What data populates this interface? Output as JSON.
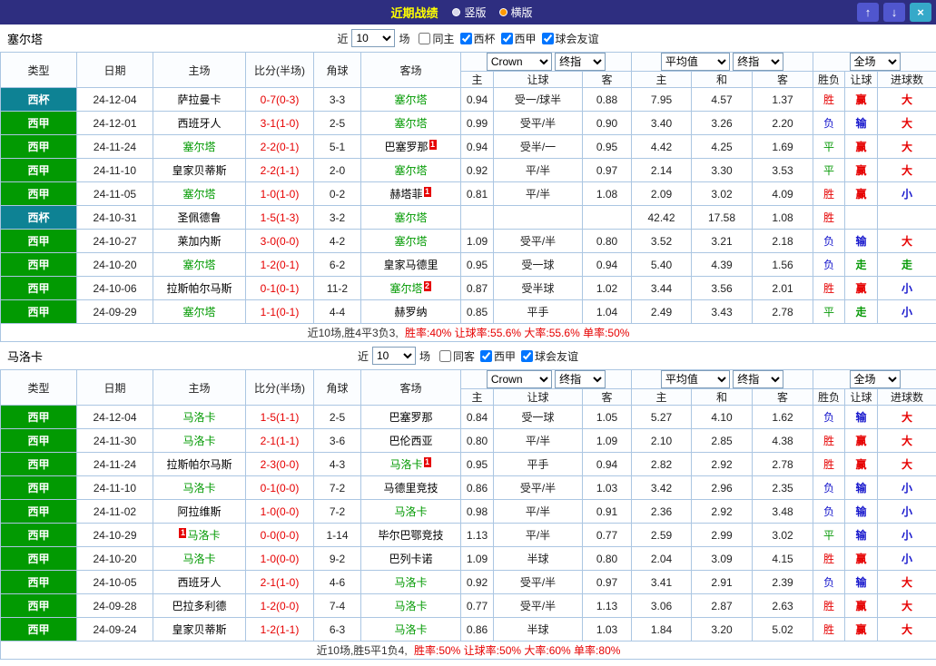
{
  "topbar": {
    "title": "近期战绩",
    "layout_radios": [
      {
        "label": "竖版",
        "selected": false
      },
      {
        "label": "横版",
        "selected": true
      }
    ],
    "buttons": {
      "up": "↑",
      "down": "↓",
      "close": "×"
    }
  },
  "table": {
    "main_columns": [
      "类型",
      "日期",
      "主场",
      "比分(半场)",
      "角球",
      "客场"
    ],
    "sub_columns": [
      "主",
      "让球",
      "客",
      "主",
      "和",
      "客",
      "胜负",
      "让球",
      "进球数"
    ],
    "controls": {
      "company": "Crown",
      "company_type": "终指",
      "euro": "平均值",
      "euro_type": "终指",
      "scope": "全场"
    }
  },
  "sections": [
    {
      "team": "塞尔塔",
      "filter": {
        "prefix": "近",
        "count": "10",
        "suffix": "场",
        "checkboxes": [
          {
            "label": "同主",
            "checked": false
          },
          {
            "label": "西杯",
            "checked": true
          },
          {
            "label": "西甲",
            "checked": true
          },
          {
            "label": "球会友谊",
            "checked": true
          }
        ]
      },
      "rows": [
        {
          "type": "西杯",
          "kind": "cup",
          "date": "24-12-04",
          "home": {
            "name": "萨拉曼卡"
          },
          "score": "0-7(0-3)",
          "corners": "3-3",
          "away": {
            "name": "塞尔塔",
            "focal": true
          },
          "asian": [
            "0.94",
            "受一/球半",
            "0.88"
          ],
          "euro": [
            "7.95",
            "4.57",
            "1.37"
          ],
          "outcome": [
            "胜",
            "r"
          ],
          "hcp": [
            "赢",
            "r"
          ],
          "goal": [
            "大",
            "r"
          ]
        },
        {
          "type": "西甲",
          "kind": "liga",
          "date": "24-12-01",
          "home": {
            "name": "西班牙人"
          },
          "score": "3-1(1-0)",
          "corners": "2-5",
          "away": {
            "name": "塞尔塔",
            "focal": true
          },
          "asian": [
            "0.99",
            "受平/半",
            "0.90"
          ],
          "euro": [
            "3.40",
            "3.26",
            "2.20"
          ],
          "outcome": [
            "负",
            "b"
          ],
          "hcp": [
            "输",
            "b"
          ],
          "goal": [
            "大",
            "r"
          ]
        },
        {
          "type": "西甲",
          "kind": "liga",
          "date": "24-11-24",
          "home": {
            "name": "塞尔塔",
            "focal": true
          },
          "score": "2-2(0-1)",
          "corners": "5-1",
          "away": {
            "name": "巴塞罗那",
            "badge": "1"
          },
          "asian": [
            "0.94",
            "受半/一",
            "0.95"
          ],
          "euro": [
            "4.42",
            "4.25",
            "1.69"
          ],
          "outcome": [
            "平",
            "g"
          ],
          "hcp": [
            "赢",
            "r"
          ],
          "goal": [
            "大",
            "r"
          ]
        },
        {
          "type": "西甲",
          "kind": "liga",
          "date": "24-11-10",
          "home": {
            "name": "皇家贝蒂斯"
          },
          "score": "2-2(1-1)",
          "corners": "2-0",
          "away": {
            "name": "塞尔塔",
            "focal": true
          },
          "asian": [
            "0.92",
            "平/半",
            "0.97"
          ],
          "euro": [
            "2.14",
            "3.30",
            "3.53"
          ],
          "outcome": [
            "平",
            "g"
          ],
          "hcp": [
            "赢",
            "r"
          ],
          "goal": [
            "大",
            "r"
          ]
        },
        {
          "type": "西甲",
          "kind": "liga",
          "date": "24-11-05",
          "home": {
            "name": "塞尔塔",
            "focal": true
          },
          "score": "1-0(1-0)",
          "corners": "0-2",
          "away": {
            "name": "赫塔菲",
            "badge": "1"
          },
          "asian": [
            "0.81",
            "平/半",
            "1.08"
          ],
          "euro": [
            "2.09",
            "3.02",
            "4.09"
          ],
          "outcome": [
            "胜",
            "r"
          ],
          "hcp": [
            "赢",
            "r"
          ],
          "goal": [
            "小",
            "b"
          ]
        },
        {
          "type": "西杯",
          "kind": "cup",
          "date": "24-10-31",
          "home": {
            "name": "圣佩德鲁"
          },
          "score": "1-5(1-3)",
          "corners": "3-2",
          "away": {
            "name": "塞尔塔",
            "focal": true
          },
          "asian": [
            "",
            "",
            ""
          ],
          "euro": [
            "42.42",
            "17.58",
            "1.08"
          ],
          "outcome": [
            "胜",
            "r"
          ],
          "hcp": [
            "",
            ""
          ],
          "goal": [
            "",
            ""
          ]
        },
        {
          "type": "西甲",
          "kind": "liga",
          "date": "24-10-27",
          "home": {
            "name": "莱加内斯"
          },
          "score": "3-0(0-0)",
          "corners": "4-2",
          "away": {
            "name": "塞尔塔",
            "focal": true
          },
          "asian": [
            "1.09",
            "受平/半",
            "0.80"
          ],
          "euro": [
            "3.52",
            "3.21",
            "2.18"
          ],
          "outcome": [
            "负",
            "b"
          ],
          "hcp": [
            "输",
            "b"
          ],
          "goal": [
            "大",
            "r"
          ]
        },
        {
          "type": "西甲",
          "kind": "liga",
          "date": "24-10-20",
          "home": {
            "name": "塞尔塔",
            "focal": true
          },
          "score": "1-2(0-1)",
          "corners": "6-2",
          "away": {
            "name": "皇家马德里"
          },
          "asian": [
            "0.95",
            "受一球",
            "0.94"
          ],
          "euro": [
            "5.40",
            "4.39",
            "1.56"
          ],
          "outcome": [
            "负",
            "b"
          ],
          "hcp": [
            "走",
            "g"
          ],
          "goal": [
            "走",
            "g"
          ]
        },
        {
          "type": "西甲",
          "kind": "liga",
          "date": "24-10-06",
          "home": {
            "name": "拉斯帕尔马斯"
          },
          "score": "0-1(0-1)",
          "corners": "11-2",
          "away": {
            "name": "塞尔塔",
            "focal": true,
            "badge": "2"
          },
          "asian": [
            "0.87",
            "受半球",
            "1.02"
          ],
          "euro": [
            "3.44",
            "3.56",
            "2.01"
          ],
          "outcome": [
            "胜",
            "r"
          ],
          "hcp": [
            "赢",
            "r"
          ],
          "goal": [
            "小",
            "b"
          ]
        },
        {
          "type": "西甲",
          "kind": "liga",
          "date": "24-09-29",
          "home": {
            "name": "塞尔塔",
            "focal": true
          },
          "score": "1-1(0-1)",
          "corners": "4-4",
          "away": {
            "name": "赫罗纳"
          },
          "asian": [
            "0.85",
            "平手",
            "1.04"
          ],
          "euro": [
            "2.49",
            "3.43",
            "2.78"
          ],
          "outcome": [
            "平",
            "g"
          ],
          "hcp": [
            "走",
            "g"
          ],
          "goal": [
            "小",
            "b"
          ]
        }
      ],
      "summary": {
        "record": "近10场,胜4平3负3,",
        "rates": "胜率:40% 让球率:55.6% 大率:55.6% 单率:50%"
      }
    },
    {
      "team": "马洛卡",
      "filter": {
        "prefix": "近",
        "count": "10",
        "suffix": "场",
        "checkboxes": [
          {
            "label": "同客",
            "checked": false
          },
          {
            "label": "西甲",
            "checked": true
          },
          {
            "label": "球会友谊",
            "checked": true
          }
        ]
      },
      "rows": [
        {
          "type": "西甲",
          "kind": "liga",
          "date": "24-12-04",
          "home": {
            "name": "马洛卡",
            "focal": true
          },
          "score": "1-5(1-1)",
          "corners": "2-5",
          "away": {
            "name": "巴塞罗那"
          },
          "asian": [
            "0.84",
            "受一球",
            "1.05"
          ],
          "euro": [
            "5.27",
            "4.10",
            "1.62"
          ],
          "outcome": [
            "负",
            "b"
          ],
          "hcp": [
            "输",
            "b"
          ],
          "goal": [
            "大",
            "r"
          ]
        },
        {
          "type": "西甲",
          "kind": "liga",
          "date": "24-11-30",
          "home": {
            "name": "马洛卡",
            "focal": true
          },
          "score": "2-1(1-1)",
          "corners": "3-6",
          "away": {
            "name": "巴伦西亚"
          },
          "asian": [
            "0.80",
            "平/半",
            "1.09"
          ],
          "euro": [
            "2.10",
            "2.85",
            "4.38"
          ],
          "outcome": [
            "胜",
            "r"
          ],
          "hcp": [
            "赢",
            "r"
          ],
          "goal": [
            "大",
            "r"
          ]
        },
        {
          "type": "西甲",
          "kind": "liga",
          "date": "24-11-24",
          "home": {
            "name": "拉斯帕尔马斯"
          },
          "score": "2-3(0-0)",
          "corners": "4-3",
          "away": {
            "name": "马洛卡",
            "focal": true,
            "badge": "1"
          },
          "asian": [
            "0.95",
            "平手",
            "0.94"
          ],
          "euro": [
            "2.82",
            "2.92",
            "2.78"
          ],
          "outcome": [
            "胜",
            "r"
          ],
          "hcp": [
            "赢",
            "r"
          ],
          "goal": [
            "大",
            "r"
          ]
        },
        {
          "type": "西甲",
          "kind": "liga",
          "date": "24-11-10",
          "home": {
            "name": "马洛卡",
            "focal": true
          },
          "score": "0-1(0-0)",
          "corners": "7-2",
          "away": {
            "name": "马德里竞技"
          },
          "asian": [
            "0.86",
            "受平/半",
            "1.03"
          ],
          "euro": [
            "3.42",
            "2.96",
            "2.35"
          ],
          "outcome": [
            "负",
            "b"
          ],
          "hcp": [
            "输",
            "b"
          ],
          "goal": [
            "小",
            "b"
          ]
        },
        {
          "type": "西甲",
          "kind": "liga",
          "date": "24-11-02",
          "home": {
            "name": "阿拉维斯"
          },
          "score": "1-0(0-0)",
          "corners": "7-2",
          "away": {
            "name": "马洛卡",
            "focal": true
          },
          "asian": [
            "0.98",
            "平/半",
            "0.91"
          ],
          "euro": [
            "2.36",
            "2.92",
            "3.48"
          ],
          "outcome": [
            "负",
            "b"
          ],
          "hcp": [
            "输",
            "b"
          ],
          "goal": [
            "小",
            "b"
          ]
        },
        {
          "type": "西甲",
          "kind": "liga",
          "date": "24-10-29",
          "home": {
            "name": "马洛卡",
            "focal": true,
            "badge": "1",
            "badge_pos": "before"
          },
          "score": "0-0(0-0)",
          "corners": "1-14",
          "away": {
            "name": "毕尔巴鄂竞技"
          },
          "asian": [
            "1.13",
            "平/半",
            "0.77"
          ],
          "euro": [
            "2.59",
            "2.99",
            "3.02"
          ],
          "outcome": [
            "平",
            "g"
          ],
          "hcp": [
            "输",
            "b"
          ],
          "goal": [
            "小",
            "b"
          ]
        },
        {
          "type": "西甲",
          "kind": "liga",
          "date": "24-10-20",
          "home": {
            "name": "马洛卡",
            "focal": true
          },
          "score": "1-0(0-0)",
          "corners": "9-2",
          "away": {
            "name": "巴列卡诺"
          },
          "asian": [
            "1.09",
            "半球",
            "0.80"
          ],
          "euro": [
            "2.04",
            "3.09",
            "4.15"
          ],
          "outcome": [
            "胜",
            "r"
          ],
          "hcp": [
            "赢",
            "r"
          ],
          "goal": [
            "小",
            "b"
          ]
        },
        {
          "type": "西甲",
          "kind": "liga",
          "date": "24-10-05",
          "home": {
            "name": "西班牙人"
          },
          "score": "2-1(1-0)",
          "corners": "4-6",
          "away": {
            "name": "马洛卡",
            "focal": true
          },
          "asian": [
            "0.92",
            "受平/半",
            "0.97"
          ],
          "euro": [
            "3.41",
            "2.91",
            "2.39"
          ],
          "outcome": [
            "负",
            "b"
          ],
          "hcp": [
            "输",
            "b"
          ],
          "goal": [
            "大",
            "r"
          ]
        },
        {
          "type": "西甲",
          "kind": "liga",
          "date": "24-09-28",
          "home": {
            "name": "巴拉多利德"
          },
          "score": "1-2(0-0)",
          "corners": "7-4",
          "away": {
            "name": "马洛卡",
            "focal": true
          },
          "asian": [
            "0.77",
            "受平/半",
            "1.13"
          ],
          "euro": [
            "3.06",
            "2.87",
            "2.63"
          ],
          "outcome": [
            "胜",
            "r"
          ],
          "hcp": [
            "赢",
            "r"
          ],
          "goal": [
            "大",
            "r"
          ]
        },
        {
          "type": "西甲",
          "kind": "liga",
          "date": "24-09-24",
          "home": {
            "name": "皇家贝蒂斯"
          },
          "score": "1-2(1-1)",
          "corners": "6-3",
          "away": {
            "name": "马洛卡",
            "focal": true
          },
          "asian": [
            "0.86",
            "半球",
            "1.03"
          ],
          "euro": [
            "1.84",
            "3.20",
            "5.02"
          ],
          "outcome": [
            "胜",
            "r"
          ],
          "hcp": [
            "赢",
            "r"
          ],
          "goal": [
            "大",
            "r"
          ]
        }
      ],
      "summary": {
        "record": "近10场,胜5平1负4,",
        "rates": "胜率:50% 让球率:50% 大率:60% 单率:80%"
      }
    }
  ]
}
